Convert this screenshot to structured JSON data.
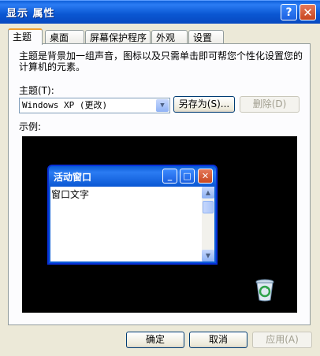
{
  "window": {
    "title": "显示 属性",
    "help_label": "?",
    "close_label": "✕"
  },
  "tabs": [
    {
      "label": "主题",
      "active": true
    },
    {
      "label": "桌面",
      "active": false
    },
    {
      "label": "屏幕保护程序",
      "active": false
    },
    {
      "label": "外观",
      "active": false
    },
    {
      "label": "设置",
      "active": false
    }
  ],
  "theme_tab": {
    "description": "主题是背景加一组声音，图标以及只需单击即可帮您个性化设置您的计算机的元素。",
    "theme_label": "主题(T):",
    "theme_value": "Windows XP (更改)",
    "save_as_label": "另存为(S)...",
    "delete_label": "删除(D)",
    "example_label": "示例:"
  },
  "preview": {
    "window_title": "活动窗口",
    "window_text": "窗口文字"
  },
  "footer": {
    "ok_label": "确定",
    "cancel_label": "取消",
    "apply_label": "应用(A)"
  },
  "colors": {
    "titlebar": "#0a5bd6",
    "dialog_bg": "#ece9d8",
    "preview_bg": "#000000"
  }
}
